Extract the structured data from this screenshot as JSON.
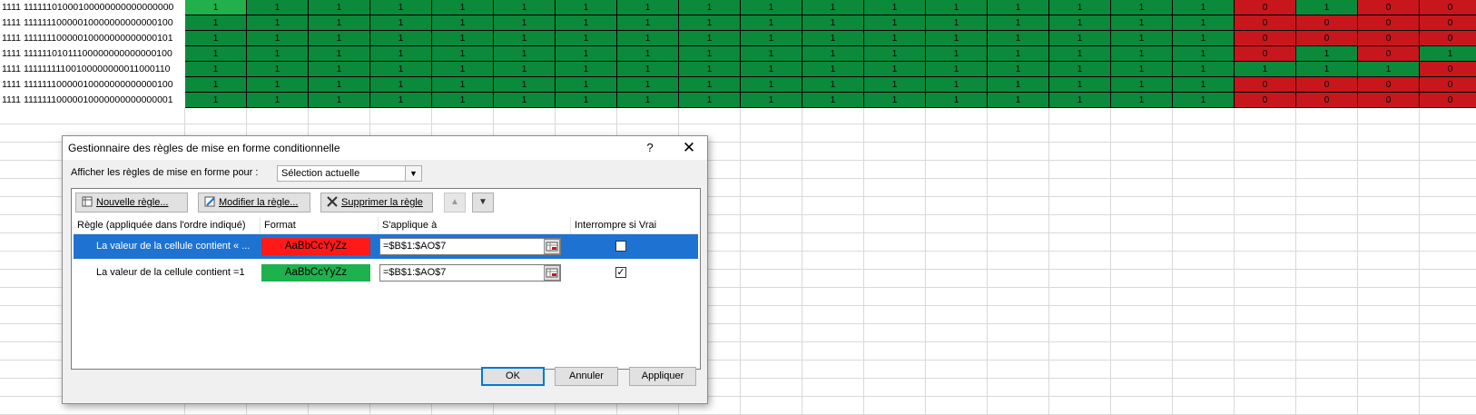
{
  "sheet": {
    "rows": [
      {
        "label": "1111 11111101000100000000000000000",
        "cells": [
          "1",
          "1",
          "1",
          "1",
          "1",
          "1",
          "1",
          "1",
          "1",
          "1",
          "1",
          "1",
          "1",
          "1",
          "1",
          "1",
          "1",
          "0",
          "1",
          "0",
          "0"
        ]
      },
      {
        "label": "1111 11111110000010000000000000100",
        "cells": [
          "1",
          "1",
          "1",
          "1",
          "1",
          "1",
          "1",
          "1",
          "1",
          "1",
          "1",
          "1",
          "1",
          "1",
          "1",
          "1",
          "1",
          "0",
          "0",
          "0",
          "0"
        ]
      },
      {
        "label": "1111 11111110000010000000000000101",
        "cells": [
          "1",
          "1",
          "1",
          "1",
          "1",
          "1",
          "1",
          "1",
          "1",
          "1",
          "1",
          "1",
          "1",
          "1",
          "1",
          "1",
          "1",
          "0",
          "0",
          "0",
          "0"
        ]
      },
      {
        "label": "1111 11111101011100000000000000100",
        "cells": [
          "1",
          "1",
          "1",
          "1",
          "1",
          "1",
          "1",
          "1",
          "1",
          "1",
          "1",
          "1",
          "1",
          "1",
          "1",
          "1",
          "1",
          "0",
          "1",
          "0",
          "1"
        ]
      },
      {
        "label": "1111 11111111100100000000011000110",
        "cells": [
          "1",
          "1",
          "1",
          "1",
          "1",
          "1",
          "1",
          "1",
          "1",
          "1",
          "1",
          "1",
          "1",
          "1",
          "1",
          "1",
          "1",
          "1",
          "1",
          "1",
          "0"
        ]
      },
      {
        "label": "1111 11111110000010000000000000100",
        "cells": [
          "1",
          "1",
          "1",
          "1",
          "1",
          "1",
          "1",
          "1",
          "1",
          "1",
          "1",
          "1",
          "1",
          "1",
          "1",
          "1",
          "1",
          "0",
          "0",
          "0",
          "0"
        ]
      },
      {
        "label": "1111 11111110000010000000000000001",
        "cells": [
          "1",
          "1",
          "1",
          "1",
          "1",
          "1",
          "1",
          "1",
          "1",
          "1",
          "1",
          "1",
          "1",
          "1",
          "1",
          "1",
          "1",
          "0",
          "0",
          "0",
          "0"
        ]
      }
    ]
  },
  "colors": {
    "green": "#0a8a3a",
    "red": "#c8161d",
    "selected_cell": "#22b04c",
    "selection_blue": "#1e73d2"
  },
  "dialog": {
    "title": "Gestionnaire des règles de mise en forme conditionnelle",
    "help": "?",
    "close": "✕",
    "show_rules_label": "Afficher les règles de mise en forme pour :",
    "show_rules_value": "Sélection actuelle",
    "toolbar": {
      "new_rule": "Nouvelle règle...",
      "edit_rule": "Modifier la règle...",
      "delete_rule": "Supprimer la règle",
      "up_icon": "arrow-up-icon",
      "down_icon": "arrow-down-icon"
    },
    "headers": {
      "rule": "Règle (appliquée dans l'ordre indiqué)",
      "format": "Format",
      "applies_to": "S'applique à",
      "stop_if_true": "Interrompre si Vrai"
    },
    "rules": [
      {
        "description": "La valeur de la cellule contient « ...",
        "format_preview": "AaBbCcYyZz",
        "format_color": "#ff1a1a",
        "applies_to": "=$B$1:$AO$7",
        "stop_if_true": false,
        "selected": true
      },
      {
        "description": "La valeur de la cellule contient =1",
        "format_preview": "AaBbCcYyZz",
        "format_color": "#1db24e",
        "applies_to": "=$B$1:$AO$7",
        "stop_if_true": true,
        "selected": false
      }
    ],
    "buttons": {
      "ok": "OK",
      "cancel": "Annuler",
      "apply": "Appliquer"
    }
  }
}
